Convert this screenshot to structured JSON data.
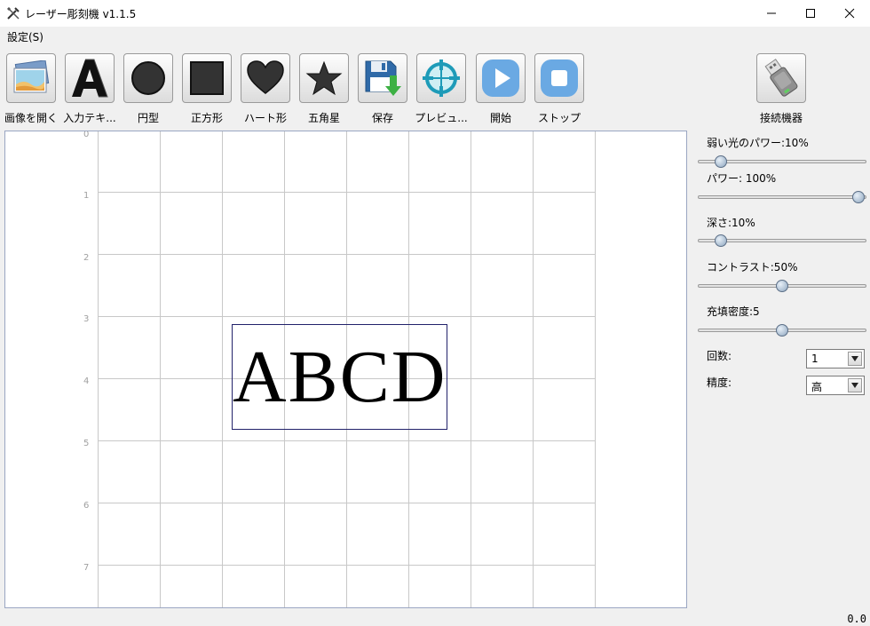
{
  "window": {
    "title": "レーザー彫刻機 v1.1.5"
  },
  "menu": {
    "settings": "設定(S)"
  },
  "toolbar": [
    {
      "label": "画像を開く",
      "icon": "image-icon"
    },
    {
      "label": "入力テキ...",
      "icon": "text-a-icon"
    },
    {
      "label": "円型",
      "icon": "circle-icon"
    },
    {
      "label": "正方形",
      "icon": "square-icon"
    },
    {
      "label": "ハート形",
      "icon": "heart-icon"
    },
    {
      "label": "五角星",
      "icon": "star-icon"
    },
    {
      "label": "保存",
      "icon": "save-icon"
    },
    {
      "label": "プレビュ...",
      "icon": "crosshair-icon"
    },
    {
      "label": "開始",
      "icon": "play-icon"
    },
    {
      "label": "ストップ",
      "icon": "stop-icon"
    }
  ],
  "device_button": {
    "label": "接続機器",
    "icon": "usb-icon"
  },
  "canvas": {
    "y_ticks": [
      "0",
      "1",
      "2",
      "3",
      "4",
      "5",
      "6",
      "7"
    ],
    "text_object": "ABCD"
  },
  "settings": {
    "weak_power": {
      "label": "弱い光のパワー:10%",
      "value": 10
    },
    "power": {
      "label": "パワー: 100%",
      "value": 100
    },
    "depth": {
      "label": "深さ:10%",
      "value": 10
    },
    "contrast": {
      "label": "コントラスト:50%",
      "value": 50
    },
    "fill_density": {
      "label": "充填密度:5",
      "value": 50
    },
    "count": {
      "label": "回数:",
      "value": "1"
    },
    "precision": {
      "label": "精度:",
      "value": "高"
    }
  },
  "status": {
    "value": "0.0"
  },
  "colors": {
    "accent": "#4a90d9",
    "save_green": "#3cb043",
    "crosshair": "#1e9bb8"
  }
}
